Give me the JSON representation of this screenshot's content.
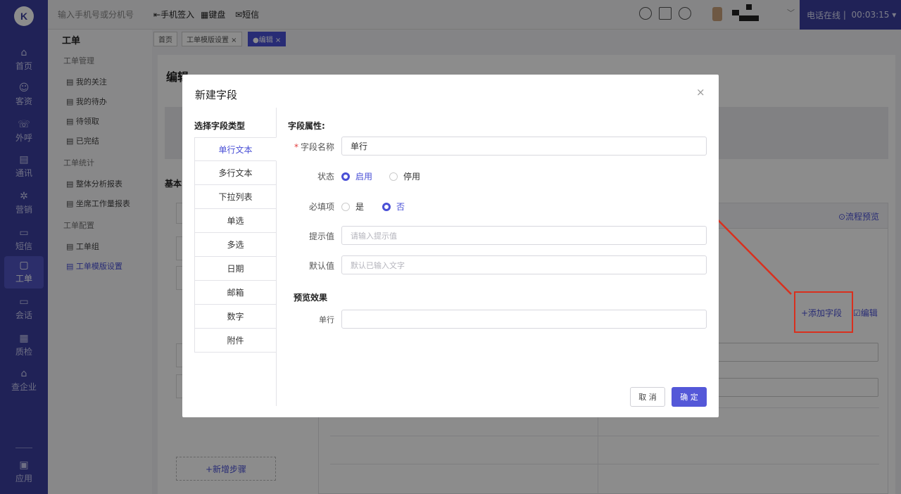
{
  "nav": {
    "logo_text": "K",
    "items": [
      {
        "label": "首页",
        "icon": "home-icon",
        "glyph": "⌂"
      },
      {
        "label": "客资",
        "icon": "user-icon",
        "glyph": "☺"
      },
      {
        "label": "外呼",
        "icon": "phone-icon",
        "glyph": "☏"
      },
      {
        "label": "通讯",
        "icon": "contacts-icon",
        "glyph": "▤"
      },
      {
        "label": "营销",
        "icon": "gear-icon",
        "glyph": "✲"
      },
      {
        "label": "短信",
        "icon": "message-icon",
        "glyph": "▭"
      },
      {
        "label": "工单",
        "icon": "clipboard-icon",
        "glyph": "▢"
      },
      {
        "label": "会话",
        "icon": "chat-icon",
        "glyph": "▭"
      },
      {
        "label": "质检",
        "icon": "inspect-icon",
        "glyph": "▦"
      },
      {
        "label": "查企业",
        "icon": "building-icon",
        "glyph": "⌂"
      },
      {
        "label": "应用",
        "icon": "apps-icon",
        "glyph": "▣"
      }
    ]
  },
  "topbar": {
    "dialer_placeholder": "输入手机号或分机号",
    "tool_signin": "手机签入",
    "tool_keypad": "键盘",
    "tool_sms": "短信",
    "status_label": "电话在线",
    "timer": "00:03:15"
  },
  "subnav": {
    "title": "工单",
    "groups": [
      {
        "heading": "工单管理",
        "items": [
          "我的关注",
          "我的待办",
          "待领取",
          "已完结"
        ]
      },
      {
        "heading": "工单统计",
        "items": [
          "整体分析报表",
          "坐席工作量报表"
        ]
      },
      {
        "heading": "工单配置",
        "items": [
          "工单组",
          "工单模版设置"
        ]
      }
    ],
    "active_item": "工单模版设置"
  },
  "tabs": [
    {
      "label": "首页"
    },
    {
      "label": "工单模版设置 ×"
    },
    {
      "label": "●编辑 ×"
    }
  ],
  "page": {
    "title": "编辑",
    "section_label": "基本",
    "flow_preview": "⊙流程预览",
    "add_field": "+添加字段",
    "edit_link": "☑编辑",
    "new_step": "+新增步骤"
  },
  "dialog": {
    "title": "新建字段",
    "close": "×",
    "type_heading": "选择字段类型",
    "types": [
      "单行文本",
      "多行文本",
      "下拉列表",
      "单选",
      "多选",
      "日期",
      "邮箱",
      "数字",
      "附件"
    ],
    "active_type": "单行文本",
    "attr_heading": "字段属性:",
    "fields": {
      "name_label": "字段名称",
      "name_value": "单行",
      "status_label": "状态",
      "status_on": "启用",
      "status_off": "停用",
      "required_label": "必填项",
      "required_yes": "是",
      "required_no": "否",
      "hint_label": "提示值",
      "hint_placeholder": "请输入提示值",
      "default_label": "默认值",
      "default_placeholder": "默认已输入文字"
    },
    "preview_heading": "预览效果",
    "preview_label": "单行",
    "preview_value": "",
    "cancel": "取 消",
    "confirm": "确 定"
  },
  "colors": {
    "nav_bg": "#3b3f9e",
    "accent": "#4a50d6",
    "annotation": "#d9301e"
  }
}
